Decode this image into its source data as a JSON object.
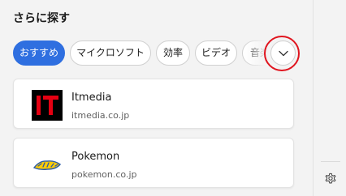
{
  "section": {
    "title": "さらに探す"
  },
  "chips": [
    {
      "label": "おすすめ",
      "active": true
    },
    {
      "label": "マイクロソフト",
      "active": false
    },
    {
      "label": "効率",
      "active": false
    },
    {
      "label": "ビデオ",
      "active": false
    },
    {
      "label": "音楽",
      "active": false
    }
  ],
  "expand_button": {
    "icon": "chevron-down-icon"
  },
  "sites": [
    {
      "name": "Itmedia",
      "domain": "itmedia.co.jp",
      "logo": "itmedia-logo",
      "logo_text": "IT"
    },
    {
      "name": "Pokemon",
      "domain": "pokemon.co.jp",
      "logo": "pokemon-logo",
      "logo_text": "Pokémon"
    }
  ],
  "rail": {
    "settings_icon": "gear-icon"
  },
  "colors": {
    "accent": "#2f6fe0",
    "highlight": "#e0141e",
    "itmedia_red": "#e60012"
  }
}
